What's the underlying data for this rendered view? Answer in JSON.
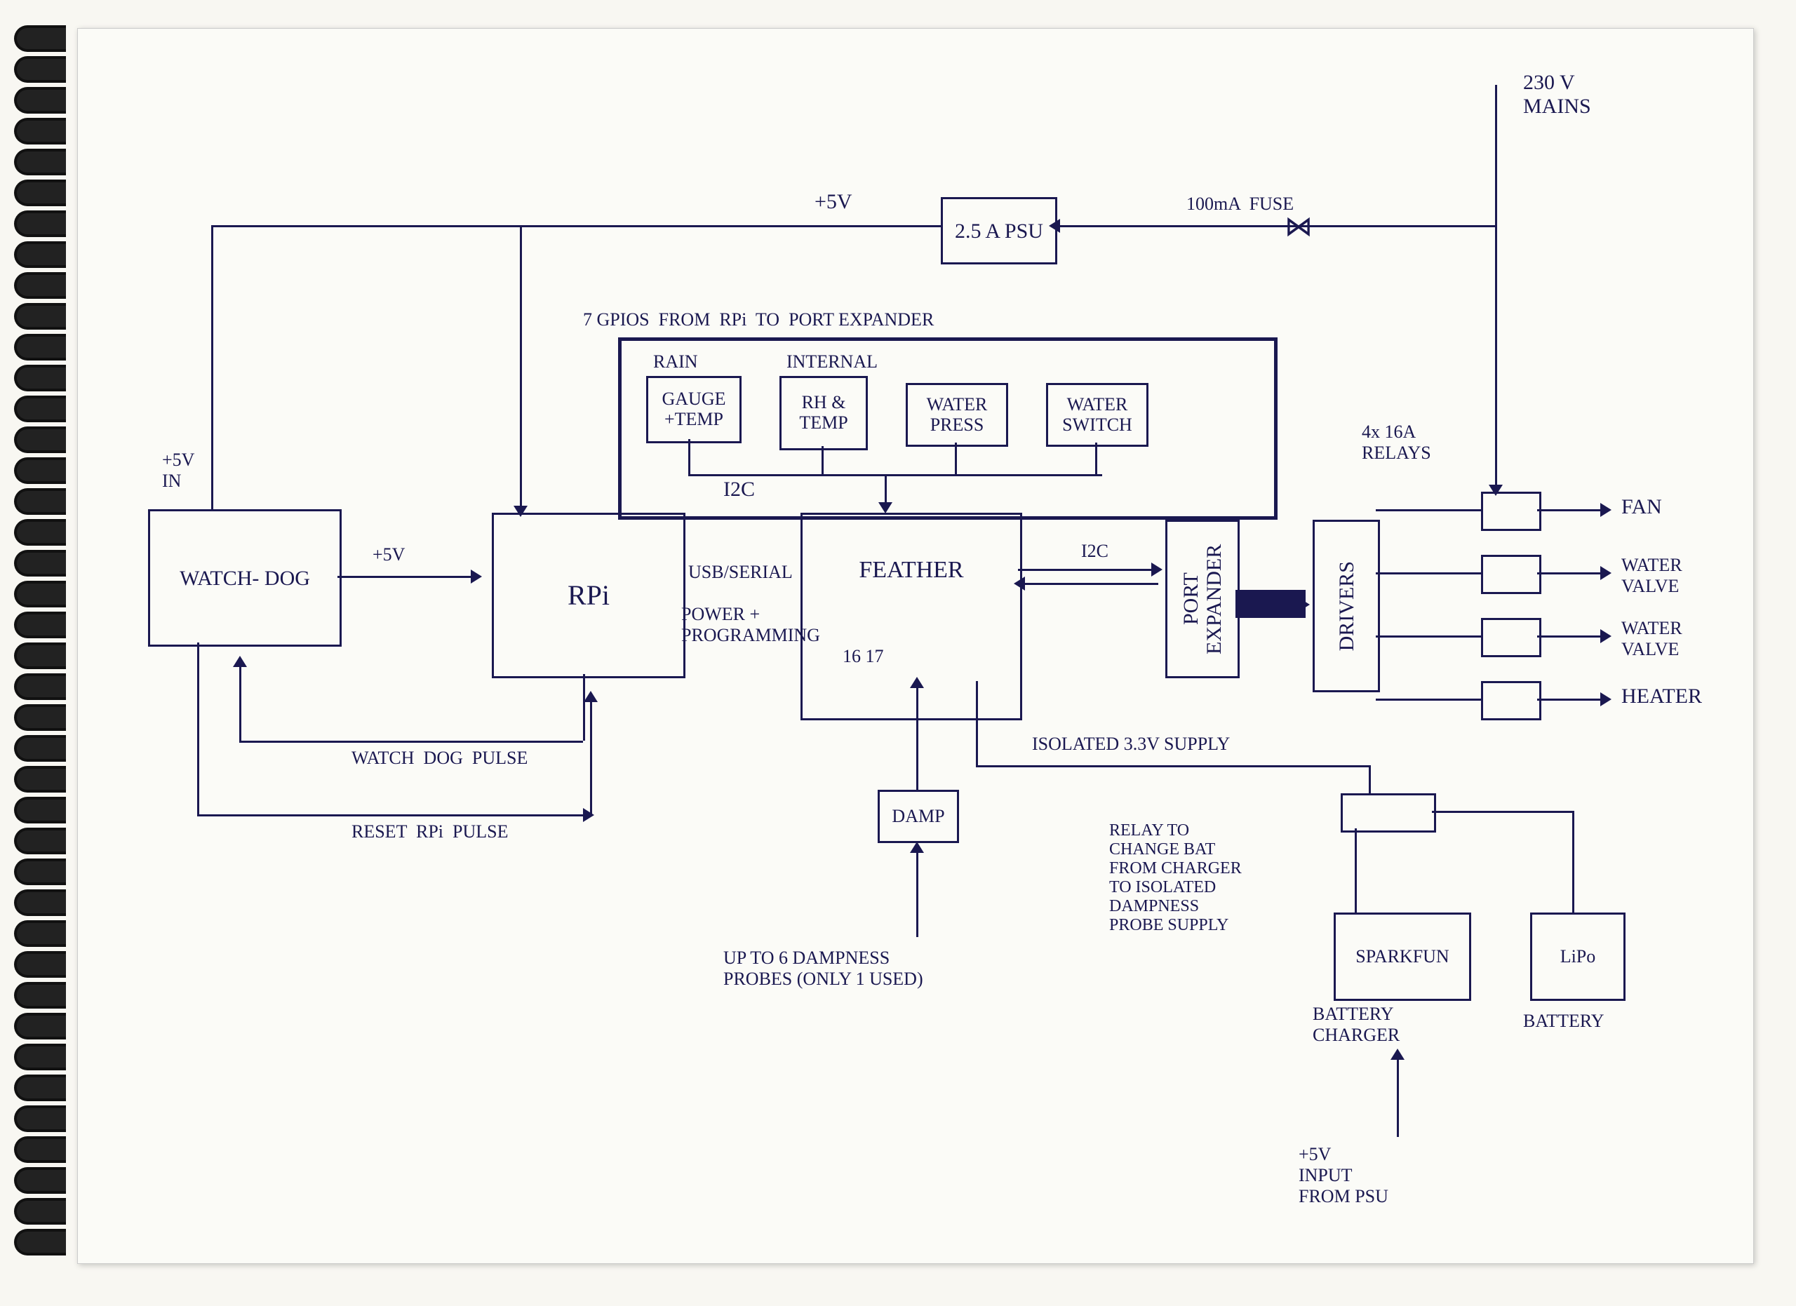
{
  "power": {
    "mains": "230 V\nMAINS",
    "fuse": "100mA  FUSE",
    "psu": "2.5 A\nPSU",
    "five_v": "+5V",
    "five_in": "+5V\nIN",
    "five_to_rpi": "+5V",
    "iso_33": "ISOLATED 3.3V SUPPLY",
    "five_in_from_psu": "+5V\nINPUT\nFROM PSU"
  },
  "blocks": {
    "watchdog": "WATCH-\nDOG",
    "rpi": "RPi",
    "feather": "FEATHER",
    "feather_pins": "16 17",
    "port_expander": "PORT\nEXPANDER",
    "drivers": "DRIVERS",
    "damp": "DAMP",
    "sparkfun": "SPARKFUN",
    "lipo": "LiPo"
  },
  "sensors": {
    "title": "7 GPIOS  FROM  RPi  TO  PORT EXPANDER",
    "rain_hdr": "RAIN",
    "rain": "GAUGE\n+TEMP",
    "int_hdr": "INTERNAL",
    "rh": "RH\n&\nTEMP",
    "press": "WATER\nPRESS",
    "switch": "WATER\nSWITCH"
  },
  "bus": {
    "i2c_a": "I2C",
    "i2c_b": "I2C",
    "usb": "USB/SERIAL",
    "pp": "POWER +\nPROGRAMMING"
  },
  "signals": {
    "wd": "WATCH  DOG  PULSE",
    "reset": "RESET  RPi  PULSE"
  },
  "damp_note": "UP TO 6 DAMPNESS\nPROBES (ONLY 1 USED)",
  "relay_note": "RELAY TO\nCHANGE BAT\nFROM CHARGER\nTO ISOLATED\nDAMPNESS\nPROBE SUPPLY",
  "relays_hdr": "4x 16A\nRELAYS",
  "outputs": {
    "fan": "FAN",
    "wv1": "WATER\nVALVE",
    "wv2": "WATER\nVALVE",
    "heater": "HEATER"
  },
  "captions": {
    "charger": "BATTERY\nCHARGER",
    "battery": "BATTERY"
  }
}
